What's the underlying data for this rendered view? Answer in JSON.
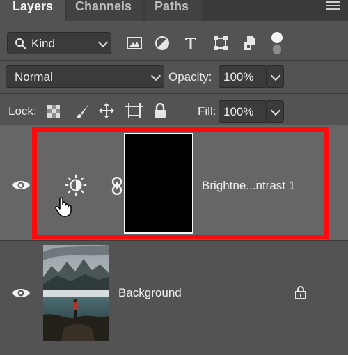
{
  "tabs": [
    {
      "label": "Layers"
    },
    {
      "label": "Channels"
    },
    {
      "label": "Paths"
    }
  ],
  "filter": {
    "kind_label": "Kind",
    "filter_icons": [
      "image-filter-icon",
      "adjustment-filter-icon",
      "type-filter-icon",
      "shape-filter-icon",
      "smart-object-filter-icon",
      "filter-toggle-icon"
    ]
  },
  "blend": {
    "mode": "Normal",
    "opacity_label": "Opacity:",
    "opacity_value": "100%"
  },
  "lock": {
    "label": "Lock:",
    "icons": [
      "lock-transparent-pixels-icon",
      "lock-image-pixels-icon",
      "lock-position-icon",
      "lock-artboard-icon",
      "lock-all-icon"
    ],
    "fill_label": "Fill:",
    "fill_value": "100%"
  },
  "layers": [
    {
      "name": "Brightne...ntrast 1",
      "selected": true,
      "type": "adjustment"
    },
    {
      "name": "Background",
      "selected": false,
      "locked": true
    }
  ],
  "colors": {
    "highlight": "#ff0a0a",
    "selected_row": "#666666",
    "panel": "#535353"
  }
}
